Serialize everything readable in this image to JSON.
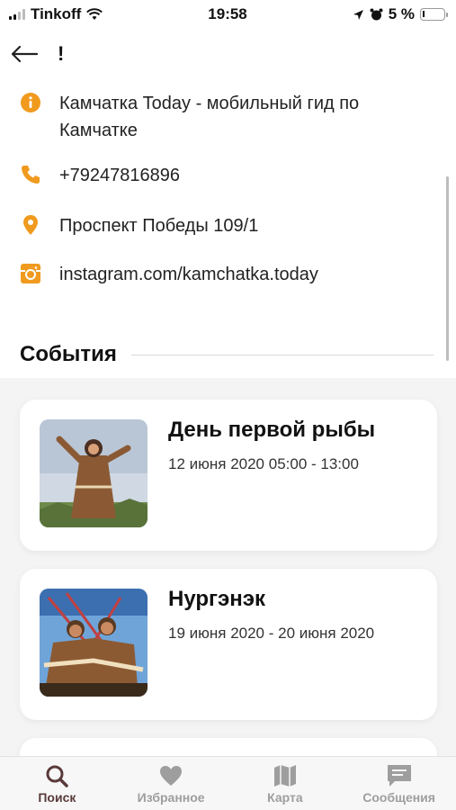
{
  "status_bar": {
    "carrier": "Tinkoff",
    "time": "19:58",
    "battery": "5 %"
  },
  "header": {
    "title": "!"
  },
  "info": {
    "about": "Камчатка Today - мобильный гид по Камчатке",
    "phone": "+79247816896",
    "address": "Проспект Победы 109/1",
    "instagram": "instagram.com/kamchatka.today"
  },
  "colors": {
    "accent": "#F09A1E",
    "active_tab": "#5A3A3A",
    "inactive_tab": "#9E9E9E"
  },
  "events": {
    "heading": "События",
    "items": [
      {
        "title": "День первой рыбы",
        "date": "12 июня 2020 05:00 - 13:00"
      },
      {
        "title": "Нургэнэк",
        "date": "19 июня 2020 - 20 июня 2020"
      }
    ]
  },
  "tabbar": {
    "items": [
      {
        "label": "Поиск",
        "icon": "search-icon",
        "active": true
      },
      {
        "label": "Избранное",
        "icon": "heart-icon",
        "active": false
      },
      {
        "label": "Карта",
        "icon": "map-icon",
        "active": false
      },
      {
        "label": "Сообщения",
        "icon": "chat-icon",
        "active": false
      }
    ]
  }
}
